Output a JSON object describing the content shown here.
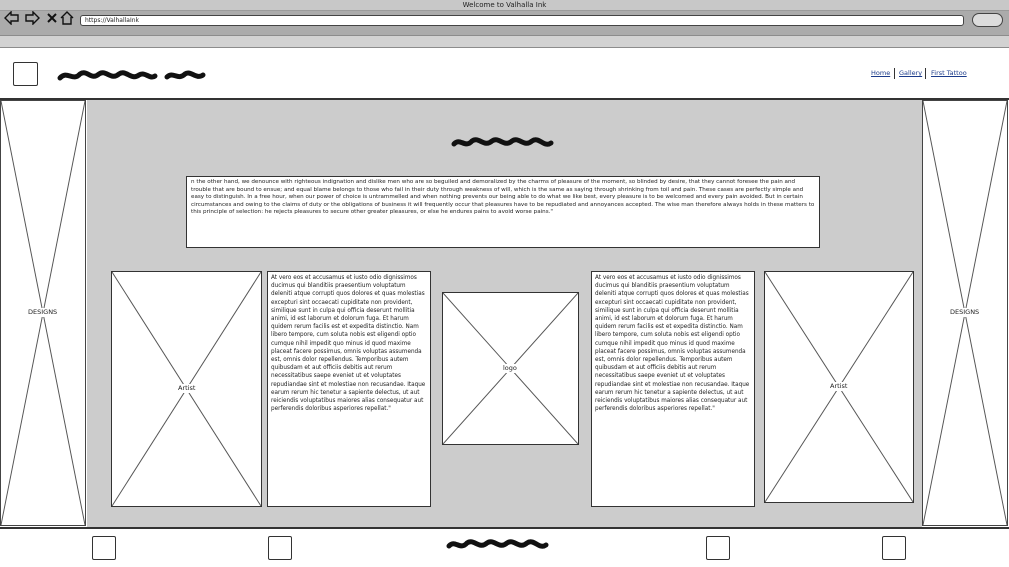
{
  "browser": {
    "window_title": "Welcome to Valhalla Ink",
    "url": "https://ValhallaInk",
    "nav_icons": [
      "back-icon",
      "forward-icon",
      "close-icon",
      "home-icon"
    ]
  },
  "header": {
    "nav": [
      {
        "label": "Home"
      },
      {
        "label": "Gallery"
      },
      {
        "label": "First Tattoo"
      }
    ]
  },
  "side_panels": {
    "left_label": "DESIGNS",
    "right_label": "DESIGNS"
  },
  "main": {
    "intro_text": "n the other hand, we denounce with righteous indignation and dislike men who are so beguiled and demoralized by the charms of pleasure of the moment, so blinded by desire, that they cannot foresee the pain and trouble that are bound to ensue; and equal blame belongs to those who fail in their duty through weakness of will, which is the same as saying through shrinking from toil and pain. These cases are perfectly simple and easy to distinguish. In a free hour, when our power of choice is untrammelled and when nothing prevents our being able to do what we like best, every pleasure is to be welcomed and every pain avoided. But in certain circumstances and owing to the claims of duty or the obligations of business it will frequently occur that pleasures have to be repudiated and annoyances accepted. The wise man therefore always holds in these matters to this principle of selection: he rejects pleasures to secure other greater pleasures, or else he endures pains to avoid worse pains.\"",
    "left_artist_label": "Artist",
    "right_artist_label": "Artist",
    "logo_label": "logo",
    "left_text": "At vero eos et accusamus et iusto odio dignissimos ducimus qui blanditiis praesentium voluptatum deleniti atque corrupti quos dolores et quas molestias excepturi sint occaecati cupiditate non provident, similique sunt in culpa qui officia deserunt mollitia animi, id est laborum et dolorum fuga. Et harum quidem rerum facilis est et expedita distinctio. Nam libero tempore, cum soluta nobis est eligendi optio cumque nihil impedit quo minus id quod maxime placeat facere possimus, omnis voluptas assumenda est, omnis dolor repellendus. Temporibus autem quibusdam et aut officiis debitis aut rerum necessitatibus saepe eveniet ut et voluptates repudiandae sint et molestiae non recusandae. Itaque earum rerum hic tenetur a sapiente delectus, ut aut reiciendis voluptatibus maiores alias consequatur aut perferendis doloribus asperiores repellat.\"",
    "right_text": "At vero eos et accusamus et iusto odio dignissimos ducimus qui blanditiis praesentium voluptatum deleniti atque corrupti quos dolores et quas molestias excepturi sint occaecati cupiditate non provident, similique sunt in culpa qui officia deserunt mollitia animi, id est laborum et dolorum fuga. Et harum quidem rerum facilis est et expedita distinctio. Nam libero tempore, cum soluta nobis est eligendi optio cumque nihil impedit quo minus id quod maxime placeat facere possimus, omnis voluptas assumenda est, omnis dolor repellendus. Temporibus autem quibusdam et aut officiis debitis aut rerum necessitatibus saepe eveniet ut et voluptates repudiandae sint et molestiae non recusandae. Itaque earum rerum hic tenetur a sapiente delectus, ut aut reiciendis voluptatibus maiores alias consequatur aut perferendis doloribus asperiores repellat.\""
  },
  "colors": {
    "link": "#1a3a8a",
    "main_background": "#cccccc",
    "chrome": "#ababab"
  }
}
